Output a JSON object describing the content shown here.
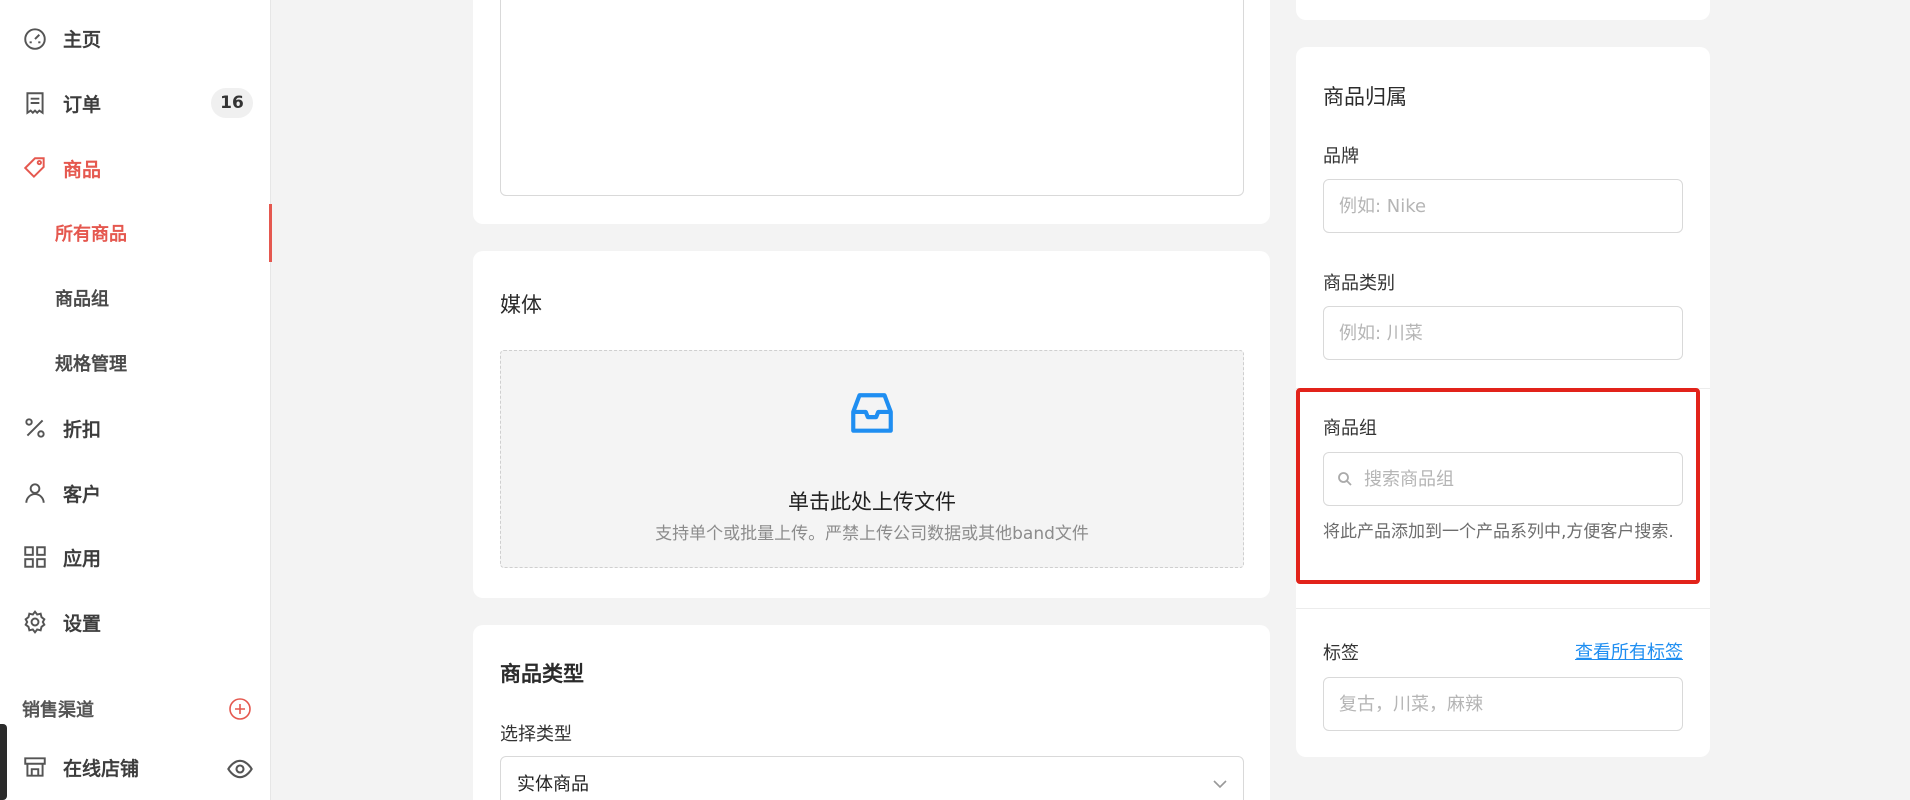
{
  "sidebar": {
    "nav": [
      {
        "label": "主页",
        "icon": "dashboard-icon"
      },
      {
        "label": "订单",
        "icon": "order-icon",
        "badge": "16"
      },
      {
        "label": "商品",
        "icon": "tag-icon"
      },
      {
        "label": "折扣",
        "icon": "percent-icon"
      },
      {
        "label": "客户",
        "icon": "user-icon"
      },
      {
        "label": "应用",
        "icon": "apps-grid-icon"
      },
      {
        "label": "设置",
        "icon": "gear-icon"
      }
    ],
    "product_sub": [
      {
        "label": "所有商品"
      },
      {
        "label": "商品组"
      },
      {
        "label": "规格管理"
      }
    ],
    "sales_channel_title": "销售渠道",
    "online_store_label": "在线店铺"
  },
  "media": {
    "title": "媒体",
    "upload_main": "单击此处上传文件",
    "upload_hint": "支持单个或批量上传。严禁上传公司数据或其他band文件"
  },
  "product_type": {
    "title": "商品类型",
    "select_label": "选择类型",
    "selected": "实体商品"
  },
  "ownership": {
    "title": "商品归属",
    "brand_label": "品牌",
    "brand_placeholder": "例如: Nike",
    "category_label": "商品类别",
    "category_placeholder": "例如: 川菜",
    "group_label": "商品组",
    "group_placeholder": "搜索商品组",
    "group_help": "将此产品添加到一个产品系列中,方便客户搜索.",
    "tags_label": "标签",
    "tags_link": "查看所有标签",
    "tags_placeholder": "复古，川菜，麻辣"
  },
  "colors": {
    "accent": "#e5584f",
    "highlight": "#e2231a",
    "link": "#1f8ef1",
    "upload_icon": "#1f8ef1"
  }
}
